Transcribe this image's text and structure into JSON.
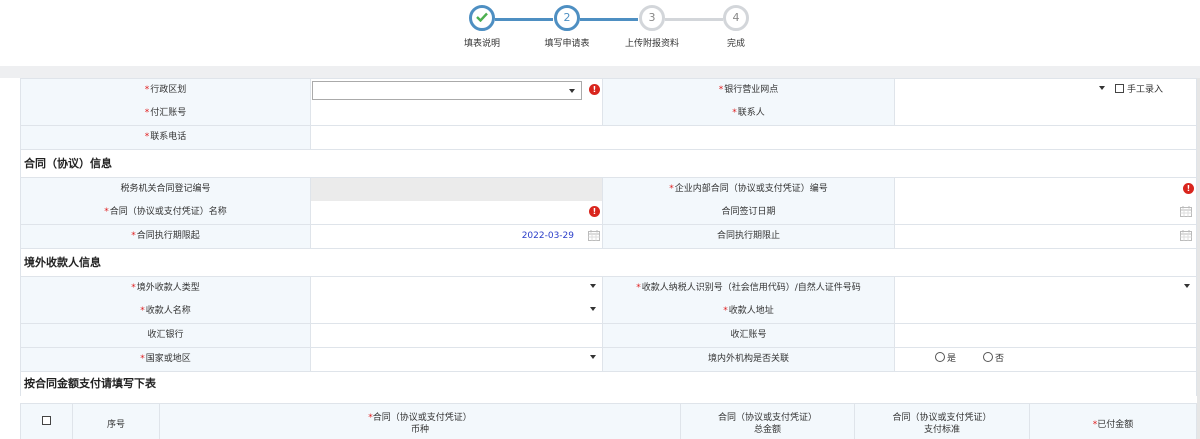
{
  "stepper": {
    "steps": [
      {
        "number": "",
        "label": "填表说明",
        "state": "done"
      },
      {
        "number": "2",
        "label": "填写申请表",
        "state": "active"
      },
      {
        "number": "3",
        "label": "上传附报资料",
        "state": "pending"
      },
      {
        "number": "4",
        "label": "完成",
        "state": "pending"
      }
    ]
  },
  "colors": {
    "accent": "#4e8fc2",
    "required": "#e02020",
    "error": "#d9251d",
    "label_bg": "#f3f8fc",
    "date_text": "#2b3ec9"
  },
  "form": {
    "required_mark": "*",
    "admin_region_label": "行政区划",
    "bank_branch_label": "银行营业网点",
    "manual_entry_label": "手工录入",
    "remit_account_label": "付汇账号",
    "contact_label": "联系人",
    "phone_label": "联系电话",
    "contract_section_title": "合同（协议）信息",
    "tax_reg_no_label": "税务机关合同登记编号",
    "internal_contract_no_label": "企业内部合同（协议或支付凭证）编号",
    "contract_name_label": "合同（协议或支付凭证）名称",
    "sign_date_label": "合同签订日期",
    "exec_start_label": "合同执行期限起",
    "exec_start_value": "2022-03-29",
    "exec_end_label": "合同执行期限止",
    "payee_section_title": "境外收款人信息",
    "payee_type_label": "境外收款人类型",
    "payee_tax_id_label": "收款人纳税人识别号（社会信用代码）/自然人证件号码",
    "payee_name_label": "收款人名称",
    "payee_address_label": "收款人地址",
    "receiving_bank_label": "收汇银行",
    "receiving_account_label": "收汇账号",
    "country_label": "国家或地区",
    "related_label": "境内外机构是否关联",
    "yes_label": "是",
    "no_label": "否",
    "amount_section_title": "按合同金额支付请填写下表"
  },
  "table": {
    "headers": {
      "seq": "序号",
      "currency_l1": "合同（协议或支付凭证）",
      "currency_l2": "币种",
      "total_l1": "合同（协议或支付凭证）",
      "total_l2": "总金额",
      "standard_l1": "合同（协议或支付凭证）",
      "standard_l2": "支付标准",
      "paid": "已付金额"
    }
  }
}
